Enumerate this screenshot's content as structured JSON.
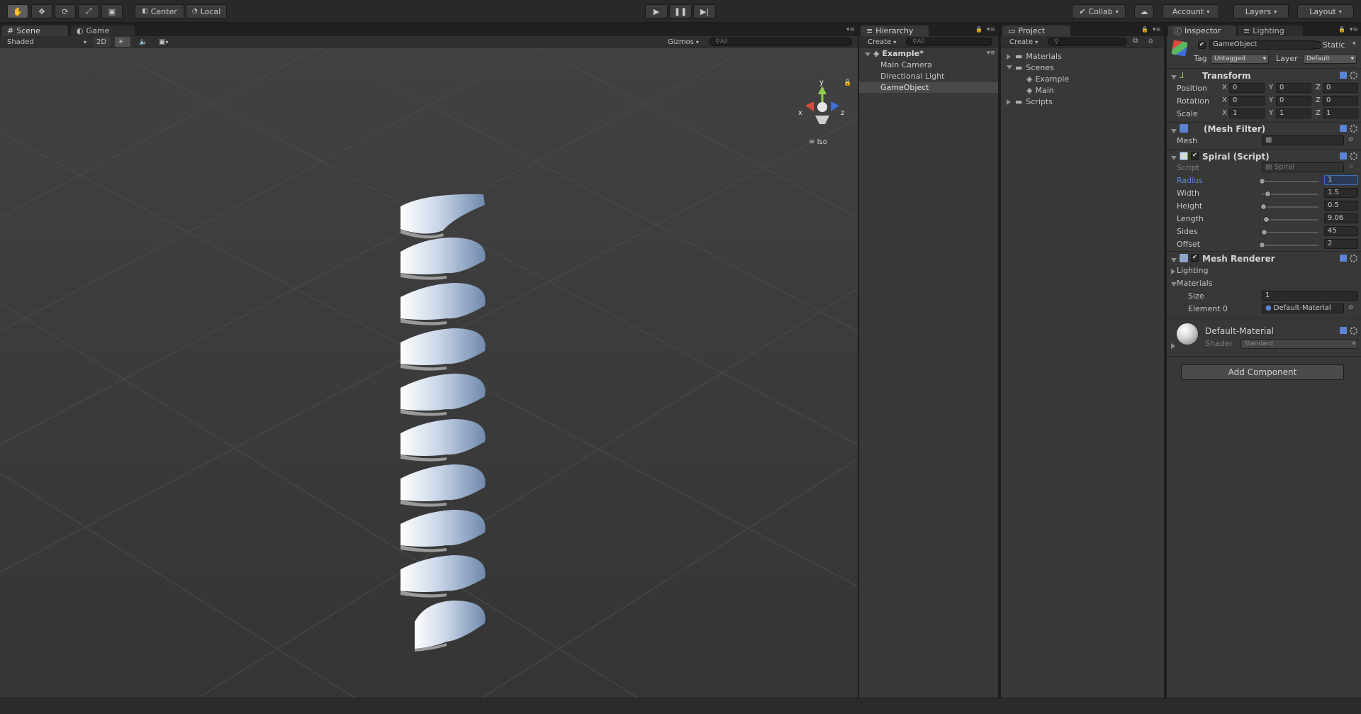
{
  "toolbar": {
    "pivot": "Center",
    "space": "Local",
    "collab": "Collab",
    "account": "Account",
    "layers": "Layers",
    "layout": "Layout"
  },
  "scene": {
    "tab_scene": "Scene",
    "tab_game": "Game",
    "shading": "Shaded",
    "mode_2d": "2D",
    "gizmos": "Gizmos",
    "search_placeholder": "All",
    "iso": "Iso",
    "axis_x": "x",
    "axis_y": "y",
    "axis_z": "z"
  },
  "hierarchy": {
    "tab": "Hierarchy",
    "create": "Create",
    "search_placeholder": "All",
    "scene_name": "Example*",
    "items": [
      "Main Camera",
      "Directional Light",
      "GameObject"
    ]
  },
  "project": {
    "tab": "Project",
    "create": "Create",
    "folders": [
      "Materials",
      "Scenes",
      "Example",
      "Main",
      "Scripts"
    ]
  },
  "inspector": {
    "tab": "Inspector",
    "tab_lighting": "Lighting",
    "object_name": "GameObject",
    "static": "Static",
    "tag_label": "Tag",
    "tag_value": "Untagged",
    "layer_label": "Layer",
    "layer_value": "Default",
    "transform": {
      "title": "Transform",
      "rows": [
        {
          "label": "Position",
          "x": "0",
          "y": "0",
          "z": "0"
        },
        {
          "label": "Rotation",
          "x": "0",
          "y": "0",
          "z": "0"
        },
        {
          "label": "Scale",
          "x": "1",
          "y": "1",
          "z": "1"
        }
      ]
    },
    "mesh_filter": {
      "title": "(Mesh Filter)",
      "mesh_label": "Mesh"
    },
    "spiral": {
      "title": "Spiral (Script)",
      "script_label": "Script",
      "script_value": "Spiral",
      "fields": [
        {
          "label": "Radius",
          "value": "1",
          "fraction": 0.0
        },
        {
          "label": "Width",
          "value": "1.5",
          "fraction": 0.1
        },
        {
          "label": "Height",
          "value": "0.5",
          "fraction": 0.03
        },
        {
          "label": "Length",
          "value": "9.06",
          "fraction": 0.08
        },
        {
          "label": "Sides",
          "value": "45",
          "fraction": 0.04
        },
        {
          "label": "Offset",
          "value": "2",
          "fraction": 0.0
        }
      ]
    },
    "mesh_renderer": {
      "title": "Mesh Renderer",
      "lighting": "Lighting",
      "materials": "Materials",
      "size_label": "Size",
      "size_value": "1",
      "element_label": "Element 0",
      "element_value": "Default-Material"
    },
    "material": {
      "name": "Default-Material",
      "shader_label": "Shader",
      "shader_value": "Standard"
    },
    "add_component": "Add Component"
  },
  "colors": {
    "accent": "#3d6fb5",
    "selection": "#3e5f96",
    "label_blue": "#5b84d6"
  }
}
